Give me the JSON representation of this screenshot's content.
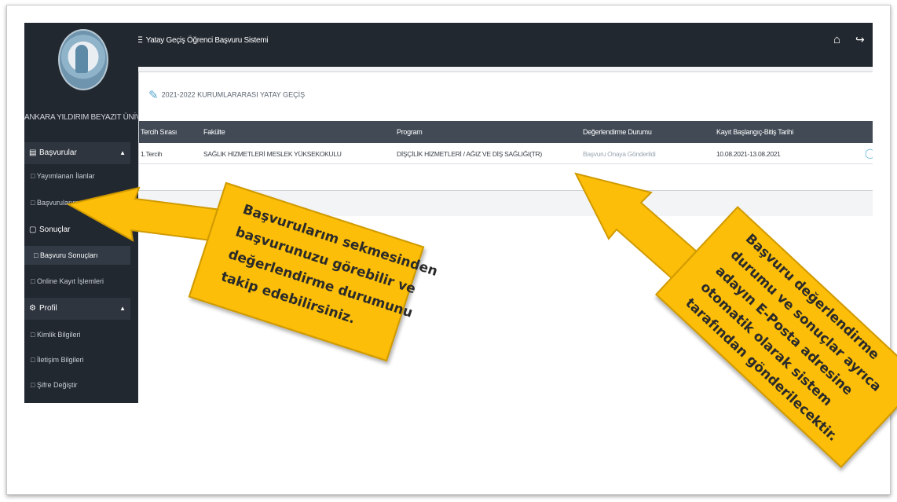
{
  "app": {
    "title": "Yatay Geçiş Öğrenci Başvuru Sistemi",
    "menu_icon": "☰",
    "university": "ANKARA YILDIRIM BEYAZIT ÜNİVERSİTESİ"
  },
  "header_icons": {
    "home": "home-icon",
    "logout": "logout-icon"
  },
  "sidebar": {
    "basvurular": {
      "label": "Başvurular",
      "items": [
        "Yayımlanan İlanlar",
        "Başvurularım"
      ]
    },
    "sonuclar": {
      "label": "Sonuçlar",
      "items": [
        "Başvuru Sonuçları",
        "Online Kayıt İşlemleri"
      ]
    },
    "profil": {
      "label": "Profil",
      "items": [
        "Kimlik Bilgileri",
        "İletişim Bilgileri",
        "Şifre Değiştir"
      ]
    }
  },
  "card": {
    "title": "2021-2022 KURUMLARARASI YATAY GEÇİŞ"
  },
  "table": {
    "headers": [
      "Tercih Sırası",
      "Fakülte",
      "Program",
      "Değerlendirme Durumu",
      "Kayıt Başlangıç-Bitiş Tarihi"
    ],
    "rows": [
      [
        "1.Tercih",
        "SAĞLIK HİZMETLERİ MESLEK YÜKSEKOKULU",
        "DİŞÇİLİK HİZMETLERİ / AĞIZ VE DİŞ SAĞLIĞI(TR)",
        "Başvuru Onaya Gönderildi",
        "10.08.2021-13.08.2021"
      ]
    ]
  },
  "callouts": {
    "left": [
      "Başvurularım sekmesinden",
      "başvurunuzu görebilir ve",
      "değerlendirme durumunu",
      "takip edebilirsiniz."
    ],
    "right": [
      "Başvuru değerlendirme",
      "durumu ve sonuçlar ayrıca",
      "adayın E-Posta adresine",
      "otomatik olarak sistem",
      "tarafından gönderilecektir."
    ]
  },
  "colors": {
    "sidebar_bg": "#222830",
    "table_header_bg": "#414a55",
    "callout_bg": "#fcbe08",
    "accent": "#59a9cf"
  }
}
